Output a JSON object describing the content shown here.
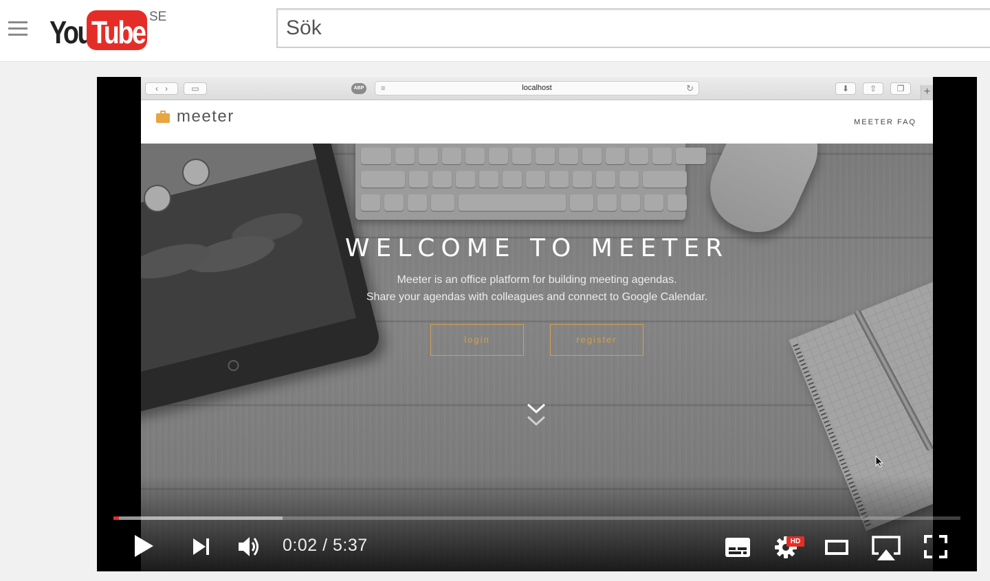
{
  "masthead": {
    "logo_you": "You",
    "logo_tube": "Tube",
    "country_code": "SE",
    "search_placeholder": "Sök"
  },
  "browser": {
    "url": "localhost",
    "adblock_label": "ABP"
  },
  "site": {
    "brand": "meeter",
    "nav_faq": "MEETER FAQ",
    "hero_title": "WELCOME TO MEETER",
    "hero_line1": "Meeter is an office platform for building meeting agendas.",
    "hero_line2": "Share your agendas with colleagues and connect to Google Calendar.",
    "login_label": "login",
    "register_label": "register",
    "accent_color": "#d4a04d"
  },
  "player": {
    "current_time": "0:02",
    "separator": "/",
    "duration": "5:37",
    "time_display": "0:02 / 5:37",
    "played_fraction": 0.006,
    "buffered_fraction": 0.2,
    "quality_badge": "HD",
    "progress_color": "#e52d27",
    "icons": [
      "play-icon",
      "next-icon",
      "volume-icon",
      "subtitles-icon",
      "settings-icon",
      "theater-mode-icon",
      "airplay-icon",
      "fullscreen-icon"
    ]
  }
}
